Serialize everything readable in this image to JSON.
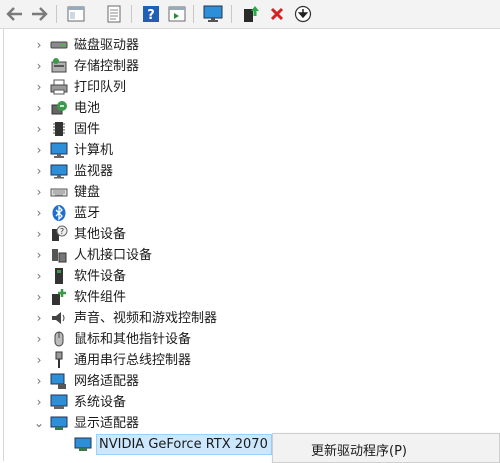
{
  "toolbar": {
    "buttons": [
      {
        "icon": "back-arrow-icon"
      },
      {
        "icon": "forward-arrow-icon"
      },
      {
        "icon": "properties-icon"
      },
      {
        "icon": "update-driver-icon"
      },
      {
        "icon": "help-icon"
      },
      {
        "icon": "action-pane-icon"
      },
      {
        "icon": "scan-hardware-icon"
      },
      {
        "icon": "add-driver-icon"
      },
      {
        "icon": "uninstall-icon"
      },
      {
        "icon": "download-icon"
      }
    ]
  },
  "tree": {
    "categories": [
      {
        "label": "磁盘驱动器",
        "icon": "disk-drive-icon"
      },
      {
        "label": "存储控制器",
        "icon": "storage-controller-icon"
      },
      {
        "label": "打印队列",
        "icon": "print-queue-icon"
      },
      {
        "label": "电池",
        "icon": "battery-icon"
      },
      {
        "label": "固件",
        "icon": "firmware-icon"
      },
      {
        "label": "计算机",
        "icon": "computer-icon"
      },
      {
        "label": "监视器",
        "icon": "monitor-icon"
      },
      {
        "label": "键盘",
        "icon": "keyboard-icon"
      },
      {
        "label": "蓝牙",
        "icon": "bluetooth-icon"
      },
      {
        "label": "其他设备",
        "icon": "other-devices-icon"
      },
      {
        "label": "人机接口设备",
        "icon": "hid-icon"
      },
      {
        "label": "软件设备",
        "icon": "software-device-icon"
      },
      {
        "label": "软件组件",
        "icon": "software-component-icon"
      },
      {
        "label": "声音、视频和游戏控制器",
        "icon": "audio-icon"
      },
      {
        "label": "鼠标和其他指针设备",
        "icon": "mouse-icon"
      },
      {
        "label": "通用串行总线控制器",
        "icon": "usb-icon"
      },
      {
        "label": "网络适配器",
        "icon": "network-adapter-icon"
      },
      {
        "label": "系统设备",
        "icon": "system-devices-icon"
      },
      {
        "label": "显示适配器",
        "icon": "display-adapter-icon",
        "expanded": true
      }
    ],
    "child": {
      "label": "NVIDIA GeForce RTX 2070",
      "icon": "display-adapter-icon"
    }
  },
  "context_menu": {
    "items": [
      {
        "label": "更新驱动程序(P)"
      }
    ]
  },
  "colors": {
    "selection_bg": "#cce8ff",
    "selection_border": "#99d1ff",
    "monitor_blue": "#2d8fd8",
    "uninstall_red": "#d42121"
  }
}
